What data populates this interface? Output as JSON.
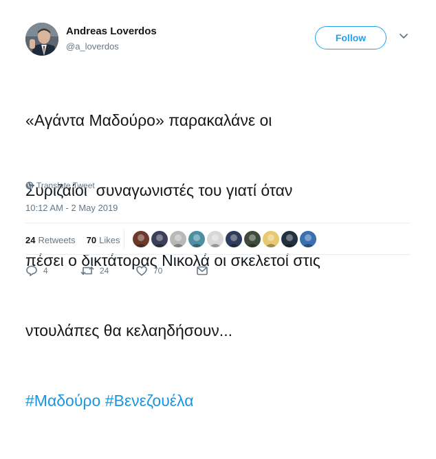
{
  "author": {
    "name": "Andreas Loverdos",
    "handle": "@a_loverdos"
  },
  "follow_button": {
    "label": "Follow"
  },
  "tweet": {
    "lines": [
      "«Αγάντα Μαδούρο» παρακαλάνε οι",
      "Συριζαίοι  συναγωνιστές του γιατί όταν",
      "πέσει ο δικτάτορας Νικολά οι σκελετοί στις",
      "ντουλάπες θα κελαηδήσουν..."
    ],
    "hashtags": [
      "#Μαδούρο",
      "#Βενεζουέλα"
    ]
  },
  "translate": {
    "label": "Translate Tweet",
    "icon": "globe-icon"
  },
  "timestamp": "10:12 AM - 2 May 2019",
  "stats": {
    "retweets_count": "24",
    "retweets_label": "Retweets",
    "likes_count": "70",
    "likes_label": "Likes"
  },
  "likers": {
    "avatar_colors": [
      "#6b3a2a",
      "#3b3f58",
      "#b8b8b8",
      "#4c8fa3",
      "#d8d8d8",
      "#2e3b5a",
      "#3f4a3a",
      "#e8c870",
      "#22313f",
      "#3a6fb0"
    ]
  },
  "actions": {
    "reply_count": "4",
    "retweet_count": "24",
    "like_count": "70"
  },
  "colors": {
    "accent": "#1da1f2",
    "hashtag": "#1b95e0",
    "muted": "#657786",
    "text": "#14171a"
  }
}
